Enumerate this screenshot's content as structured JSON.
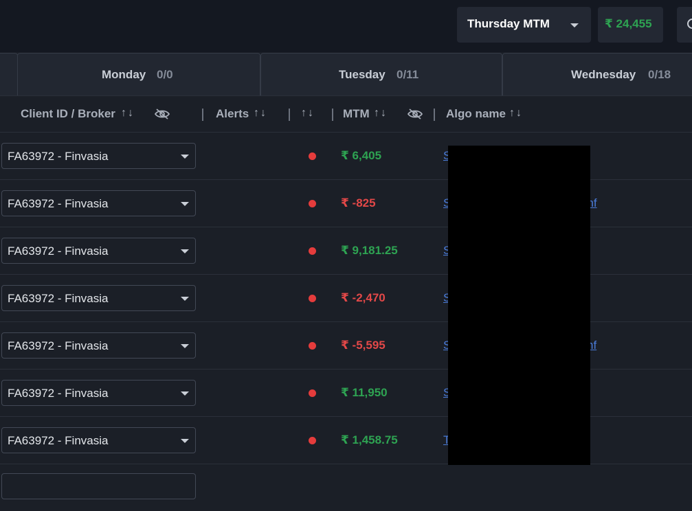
{
  "topbar": {
    "mtm_select_label": "Thursday MTM",
    "total_mtm": "₹ 24,455",
    "total_color": "#2ea352"
  },
  "day_tabs": [
    {
      "day": "Monday",
      "count": "0/0"
    },
    {
      "day": "Tuesday",
      "count": "0/11"
    },
    {
      "day": "Wednesday",
      "count": "0/18"
    }
  ],
  "table": {
    "headers": {
      "client": "Client ID / Broker",
      "alerts": "Alerts",
      "mtm": "MTM",
      "algo": "Algo name",
      "sort_icon": "↑↓"
    },
    "rows": [
      {
        "client": "FA63972 - Finvasia",
        "mtm": "₹ 6,405",
        "color": "#2ea352",
        "algo_visible": "S",
        "algo_right": ""
      },
      {
        "client": "FA63972 - Finvasia",
        "mtm": "₹ -825",
        "color": "#e34848",
        "algo_visible": "S",
        "algo_right": "bnf"
      },
      {
        "client": "FA63972 - Finvasia",
        "mtm": "₹ 9,181.25",
        "color": "#2ea352",
        "algo_visible": "S",
        "algo_right": ""
      },
      {
        "client": "FA63972 - Finvasia",
        "mtm": "₹ -2,470",
        "color": "#e34848",
        "algo_visible": "S",
        "algo_right": ""
      },
      {
        "client": "FA63972 - Finvasia",
        "mtm": "₹ -5,595",
        "color": "#e34848",
        "algo_visible": "S",
        "algo_right": "nf"
      },
      {
        "client": "FA63972 - Finvasia",
        "mtm": "₹ 11,950",
        "color": "#2ea352",
        "algo_visible": "S",
        "algo_right": ""
      },
      {
        "client": "FA63972 - Finvasia",
        "mtm": "₹ 1,458.75",
        "color": "#2ea352",
        "algo_visible": "T",
        "algo_right": ""
      }
    ]
  },
  "icons": {
    "sort": "sort-arrows-icon",
    "visibility": "eye-off-icon",
    "dropdown": "chevron-down-icon",
    "search": "search-icon",
    "alert": "alert-dot-icon"
  }
}
